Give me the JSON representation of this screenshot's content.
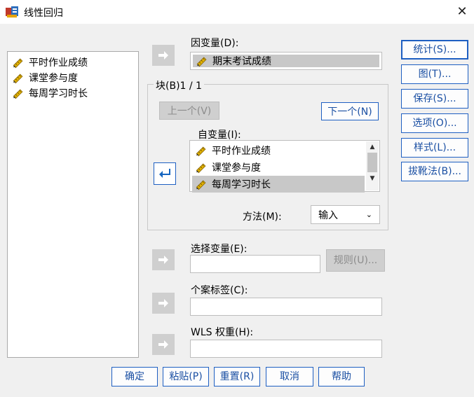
{
  "window": {
    "title": "线性回归",
    "close_icon": "close-icon"
  },
  "source_list": {
    "items": [
      {
        "label": "平时作业成绩",
        "icon": "ruler-pencil-icon"
      },
      {
        "label": "课堂参与度",
        "icon": "ruler-pencil-icon"
      },
      {
        "label": "每周学习时长",
        "icon": "ruler-pencil-icon"
      }
    ]
  },
  "dependent": {
    "label": "因变量(D):",
    "value": "期末考试成绩"
  },
  "block": {
    "label": "块(B)1 / 1",
    "prev_label": "上一个(V)",
    "next_label": "下一个(N)"
  },
  "independent": {
    "label": "自变量(I):",
    "items": [
      "平时作业成绩",
      "课堂参与度",
      "每周学习时长"
    ],
    "selected_index": 2
  },
  "method": {
    "label": "方法(M):",
    "value": "输入"
  },
  "selection_var": {
    "label": "选择变量(E):",
    "rule_label": "规则(U)..."
  },
  "case_label": {
    "label": "个案标签(C):"
  },
  "wls": {
    "label": "WLS 权重(H):"
  },
  "side_buttons": [
    {
      "label": "统计(S)..."
    },
    {
      "label": "图(T)..."
    },
    {
      "label": "保存(S)..."
    },
    {
      "label": "选项(O)..."
    },
    {
      "label": "样式(L)..."
    },
    {
      "label": "拔靴法(B)..."
    }
  ],
  "bottom_buttons": [
    {
      "label": "确定"
    },
    {
      "label": "粘贴(P)"
    },
    {
      "label": "重置(R)"
    },
    {
      "label": "取消"
    },
    {
      "label": "帮助"
    }
  ],
  "colors": {
    "accent": "#1e5fc2",
    "selection": "#c8c8c8",
    "arrow_blue": "#1565c0"
  }
}
